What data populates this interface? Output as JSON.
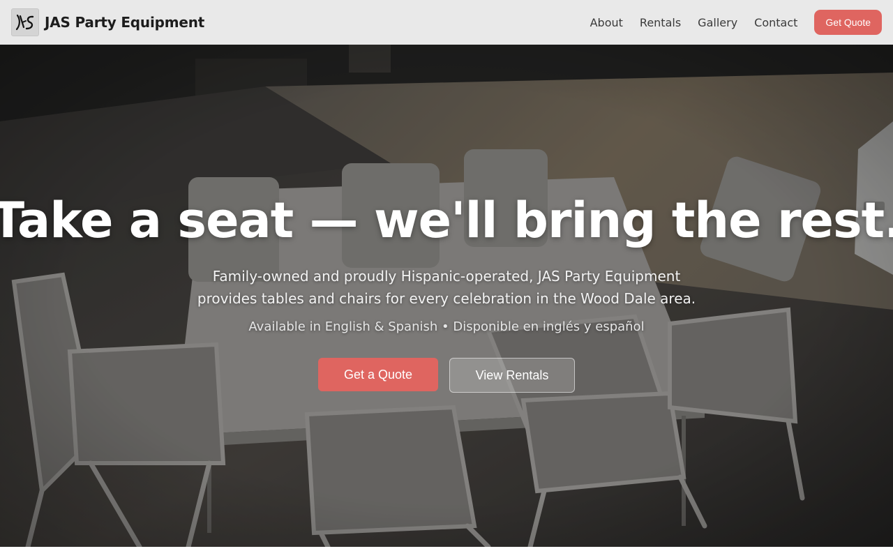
{
  "header": {
    "brand_name": "JAS Party Equipment",
    "logo_text": "JAS",
    "nav": [
      {
        "label": "About"
      },
      {
        "label": "Rentals"
      },
      {
        "label": "Gallery"
      },
      {
        "label": "Contact"
      }
    ],
    "cta_label": "Get Quote"
  },
  "hero": {
    "title": "Take a seat — we'll bring the rest.",
    "subtitle": "Family-owned and proudly Hispanic-operated, JAS Party Equipment provides tables and chairs for every celebration in the Wood Dale area.",
    "languages": "Available in English & Spanish • Disponible en inglés y español",
    "primary_button": "Get a Quote",
    "secondary_button": "View Rentals",
    "background_image": "folding-tables-and-chairs-on-driveway-photo"
  },
  "colors": {
    "accent": "#df6560",
    "header_bg": "#e9e9e9",
    "title_text": "#ffffff"
  }
}
